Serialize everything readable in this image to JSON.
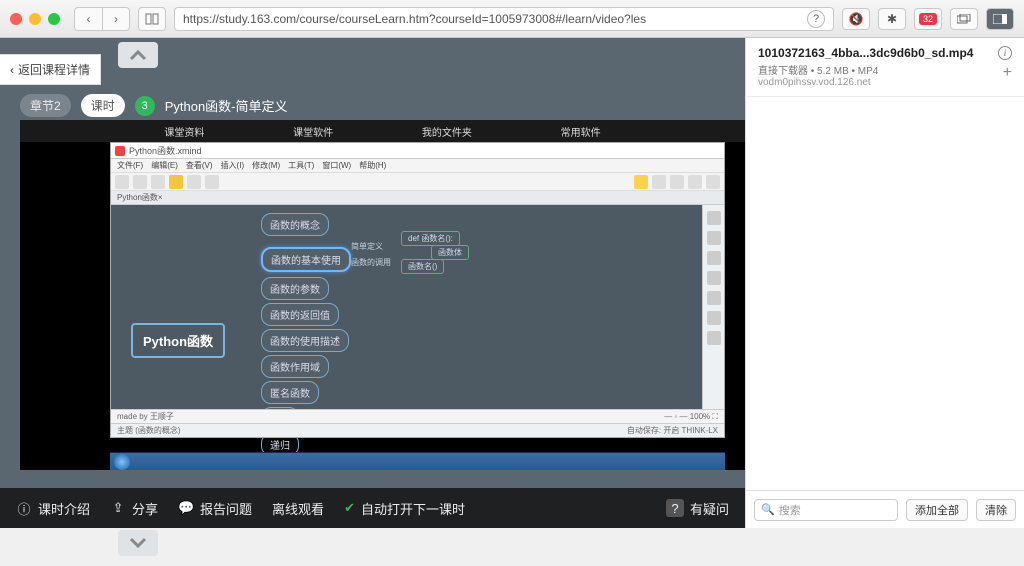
{
  "browser": {
    "url": "https://study.163.com/course/courseLearn.htm?courseId=1005973008#/learn/video?les",
    "badge_count": "32"
  },
  "course": {
    "back_label": "返回课程详情",
    "chapter_pill": "章节2",
    "lesson_pill": "课时",
    "lesson_num": "3",
    "title": "Python函数-简单定义"
  },
  "stage_tabs": [
    "课堂资料",
    "课堂软件",
    "我的文件夹",
    "常用软件"
  ],
  "xmind": {
    "window_title": "Python函数.xmind",
    "menu": [
      "文件(F)",
      "编辑(E)",
      "查看(V)",
      "插入(I)",
      "修改(M)",
      "工具(T)",
      "窗口(W)",
      "帮助(H)"
    ],
    "tab": "Python函数",
    "made_by": "made by 王顺子",
    "theme_label": "主题 (函数的概念)",
    "zoom": "100%",
    "status_right": "自动保存: 开启   THINK-LX"
  },
  "mindmap": {
    "root": "Python函数",
    "nodes": [
      "函数的概念",
      "函数的基本使用",
      "函数的参数",
      "函数的返回值",
      "函数的使用描述",
      "函数作用域",
      "匿名函数",
      "闭包",
      "递归"
    ],
    "sub_labels": {
      "a": "简单定义",
      "b": "函数的调用",
      "c": "def 函数名():",
      "d": "函数体",
      "e": "函数名()"
    }
  },
  "bottom": {
    "intro": "课时介绍",
    "share": "分享",
    "report": "报告问题",
    "offline": "离线观看",
    "autoplay": "自动打开下一课时",
    "question": "有疑问"
  },
  "downloads": {
    "file": "1010372163_4bba...3dc9d6b0_sd.mp4",
    "meta": "直接下载器 • 5.2 MB • MP4",
    "host": "vodm0pihssv.vod.126.net",
    "search_ph": "搜索",
    "add_all": "添加全部",
    "clear": "清除"
  }
}
